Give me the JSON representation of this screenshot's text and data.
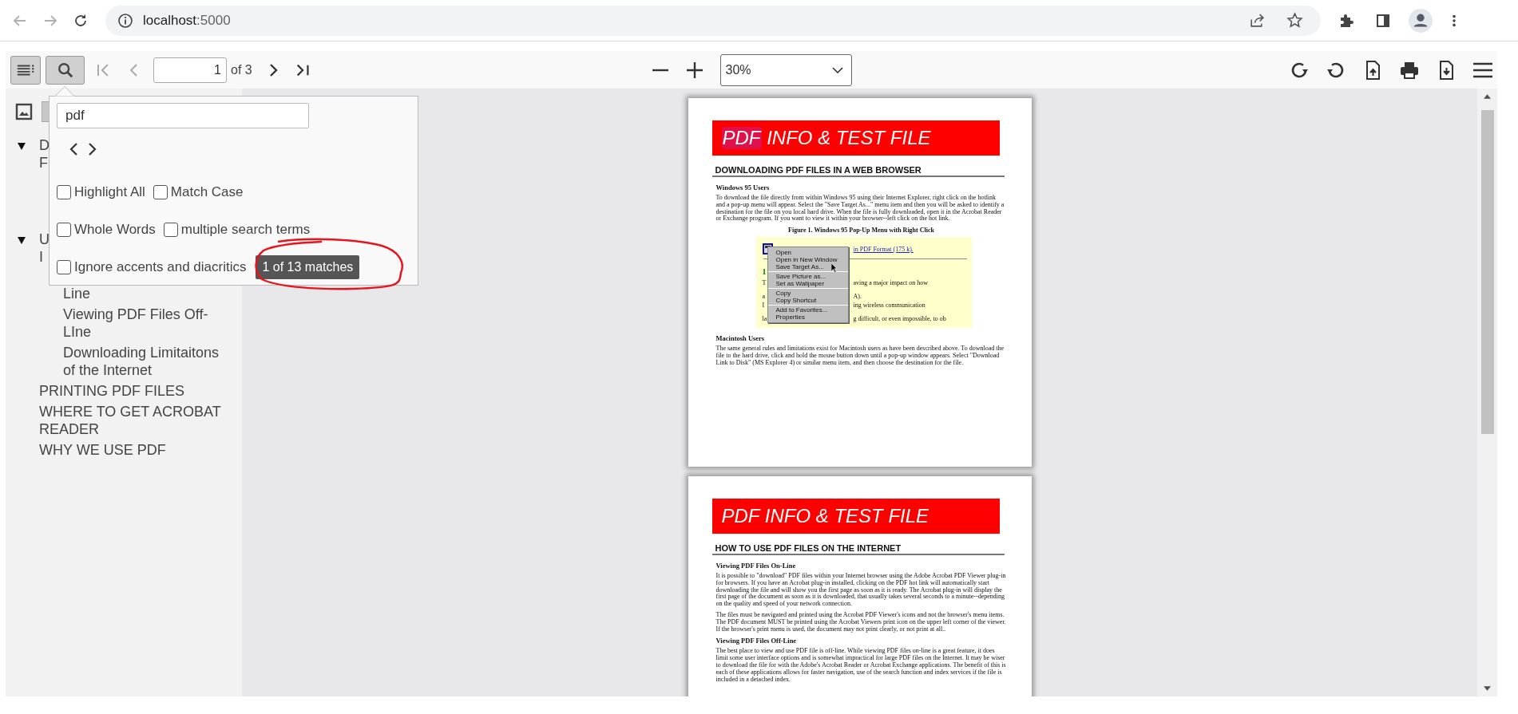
{
  "browser": {
    "url_host": "localhost",
    "url_port": ":5000"
  },
  "toolbar": {
    "sidebar_toggle": {
      "toggled": true
    },
    "find_toggle": {
      "toggled": true
    },
    "page_number": "1",
    "page_count": "of 3",
    "zoom": "30%"
  },
  "find_bar": {
    "query": "pdf",
    "options": [
      {
        "label": "Highlight All",
        "checked": false
      },
      {
        "label": "Match Case",
        "checked": false
      },
      {
        "label": "Whole Words",
        "checked": false
      },
      {
        "label": "multiple search terms",
        "checked": false
      },
      {
        "label": "Ignore accents and diacritics",
        "checked": false
      }
    ],
    "result": "1 of 13 matches"
  },
  "sidebar": {
    "views": [
      {
        "kind": "thumbnails",
        "selected": false
      },
      {
        "kind": "outline",
        "selected": true
      }
    ],
    "outline": [
      {
        "lines": [
          "D",
          "F"
        ],
        "expanded": true
      },
      {
        "lines": [
          "U",
          "I"
        ],
        "expanded": true,
        "children": [
          {
            "lines": [
              "Line"
            ]
          },
          {
            "lines": [
              "Viewing PDF Files Off-",
              "LIne"
            ]
          },
          {
            "lines": [
              "Downloading Limitaitons",
              "of the Internet"
            ]
          }
        ]
      },
      {
        "lines": [
          "PRINTING PDF FILES"
        ]
      },
      {
        "lines": [
          "WHERE TO GET ACROBAT",
          "READER"
        ]
      },
      {
        "lines": [
          "WHY WE USE PDF"
        ]
      }
    ]
  },
  "pages": [
    {
      "banner": [
        {
          "text": "PDF",
          "match": true
        },
        {
          "text": " INFO & TEST FILE",
          "match": false
        }
      ],
      "blocks": [
        {
          "kind": "heading",
          "text": "DOWNLOADING PDF FILES IN A WEB BROWSER"
        },
        {
          "kind": "subheading",
          "text": "Windows 95 Users"
        },
        {
          "kind": "paragraph",
          "text": "To download the file directly from within Windows 95 using their Internet Explorer, right click on the hotlink and a pop-up menu will appear. Select the \"Save Target As...\" menu item and then you will be asked to identify a destination for the file on you local hard drive. When the file is fully downloaded, open it in the Acrobat Reader or Exchange program. If you want to view it within your browser--left click on the hot link."
        },
        {
          "kind": "caption",
          "text": "Figure 1. Windows 95 Pop-Up Menu with Right Click"
        },
        {
          "kind": "figure",
          "link": "in PDF Format (175 k).",
          "number": "1",
          "rows": [
            {
              "left": "T",
              "right": "aving a major impact on how"
            },
            {
              "left": "a",
              "right": "A)."
            },
            {
              "left": "I",
              "right": "ing wireless communication"
            },
            {
              "left": "la",
              "right": "g difficult, or even impossible, to ob"
            }
          ],
          "menu": [
            [
              "Open",
              "Open in New Window",
              "Save Target As..."
            ],
            [
              "Save Picture as...",
              "Set as Wallpaper"
            ],
            [
              "Copy",
              "Copy Shortcut"
            ],
            [
              "Add to Favorites...",
              "Properties"
            ]
          ]
        },
        {
          "kind": "subheading",
          "text": "Macintosh Users"
        },
        {
          "kind": "paragraph",
          "text": "The same general rules and limitations exist for Macintosh users as have been described above. To download the file to the hard drive, click and hold the mouse button down until a pop-up window appears. Select \"Download Link to Disk\" (MS Explorer 4) or similar menu item, and then choose the destination for the file."
        }
      ]
    },
    {
      "banner": [
        {
          "text": "PDF INFO & TEST FILE",
          "match": false
        }
      ],
      "blocks": [
        {
          "kind": "heading",
          "text": "HOW TO USE PDF FILES ON THE INTERNET"
        },
        {
          "kind": "subheading",
          "text": "Viewing PDF Files On-Line"
        },
        {
          "kind": "paragraph",
          "text": "It is possible to \"download\" PDF files within your Internet browser using the Adobe Acrobat PDF Viewer plug-in for browsers. If you have an Acrobat plug-in installed, clicking on the PDF hot link will automatically start downloading the file and will show you the first page as soon as it is ready. The Acrobat plug-in will display the first page of the document as soon as it is downloaded, that usually takes several seconds to a minute--depending on the quality and speed of your network connection."
        },
        {
          "kind": "paragraph",
          "text": "The files must be navigated and printed using the Acrobat PDF Viewer's icons and not the browser's menu items. The PDF document MUST be printed using the Acrobat Viewers print icon on the upper left corner of the viewer. If the browser's print menu is used, the document may not print clearly, or not print at all.."
        },
        {
          "kind": "subheading",
          "text": "Viewing PDF Files Off-Line"
        },
        {
          "kind": "paragraph",
          "text": "The best place to view and use PDF file is off-line. While viewing PDF files on-line is a great feature, it does limit some user interface options and is somewhat impractical for large PDF files on the Internet. It may be wiser to download the file for with the Adobe's Acrobat Reader or Acrobat Exchange applications. The benefit of this is each of these applications allows for faster navigation, use of the search function and index services if the file is included in a detached index."
        }
      ]
    }
  ]
}
